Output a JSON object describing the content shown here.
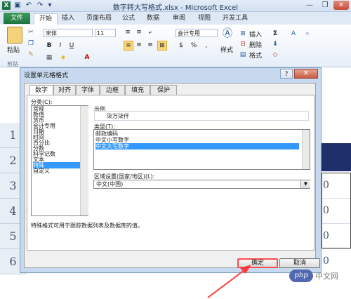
{
  "window": {
    "title": "数字转大写格式.xlsx - Microsoft Excel",
    "app_icon": "X",
    "qat_icons": [
      "save-icon",
      "undo-icon",
      "redo-icon",
      "dropdown-icon"
    ]
  },
  "ribbon": {
    "file_tab": "文件",
    "tabs": [
      "开始",
      "插入",
      "页面布局",
      "公式",
      "数据",
      "审阅",
      "视图",
      "开发工具"
    ],
    "active_tab": "开始",
    "paste_label": "粘贴",
    "font_name": "宋体",
    "font_size": "11",
    "number_format": "会计专用",
    "currency_symbol": "$",
    "percent_symbol": "%",
    "comma_symbol": ",",
    "styles_label": "样式",
    "insert_label": "插入",
    "delete_label": "删除",
    "format_label": "格式",
    "clipboard_group": "剪贴",
    "bold": "B",
    "italic": "I",
    "underline": "U",
    "font_color_letter": "A",
    "sum_symbol": "Σ",
    "sort_symbol": "A"
  },
  "sheet": {
    "row_headers": [
      "1",
      "2",
      "3",
      "4",
      "5",
      "6"
    ],
    "cell_fragments": [
      "0",
      "0",
      "0",
      "0"
    ]
  },
  "dialog": {
    "title": "设置单元格格式",
    "help": "?",
    "close": "✕",
    "tabs": [
      "数字",
      "对齐",
      "字体",
      "边框",
      "填充",
      "保护"
    ],
    "active_tab": "数字",
    "category_label": "分类(C):",
    "categories": [
      "常规",
      "数值",
      "货币",
      "会计专用",
      "日期",
      "时间",
      "百分比",
      "分数",
      "科学记数",
      "文本",
      "特殊",
      "自定义"
    ],
    "selected_category": "特殊",
    "sample_label": "示例",
    "sample_value": "柒万柒仟",
    "type_label": "类型(T):",
    "types": [
      "邮政编码",
      "中文小写数字",
      "中文大写数字"
    ],
    "selected_type": "中文大写数字",
    "locale_label": "区域设置(国家/地区)(L):",
    "locale_value": "中文(中国)",
    "description": "特殊格式可用于跟踪数据列表及数据库的值。",
    "ok": "确定",
    "cancel": "取消"
  },
  "watermark": {
    "logo": "php",
    "text": "中文网"
  },
  "colors": {
    "selection": "#3399ff",
    "file_tab": "#1e7441",
    "dialog_frame": "#c7d9ef",
    "highlight_red": "#ff3b3b"
  }
}
